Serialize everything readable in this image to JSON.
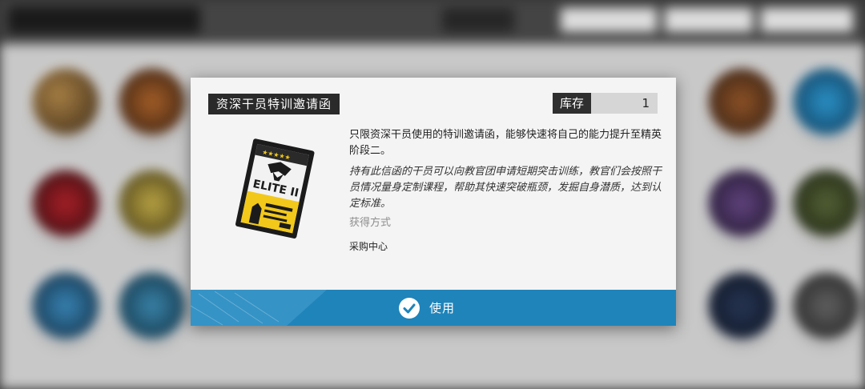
{
  "modal": {
    "title": "资深干员特训邀请函",
    "stock_label": "库存",
    "stock_value": "1",
    "description": "只限资深干员使用的特训邀请函，能够快速将自己的能力提升至精英阶段二。",
    "flavor_text": "持有此信函的干员可以向教官团申请短期突击训练，教官们会按照干员情况量身定制课程，帮助其快速突破瓶颈，发掘自身潜质，达到认定标准。",
    "obtain_label": "获得方式",
    "obtain_value": "采购中心",
    "use_label": "使用",
    "item_image": {
      "icon": "elite-ii-invitation-card-icon",
      "logo_text": "ELITE II"
    }
  },
  "colors": {
    "accent_blue": "#1f84ba",
    "title_bg": "#2a2a2a",
    "stock_bg": "#d6d6d6",
    "card_yellow": "#f2c81b"
  }
}
